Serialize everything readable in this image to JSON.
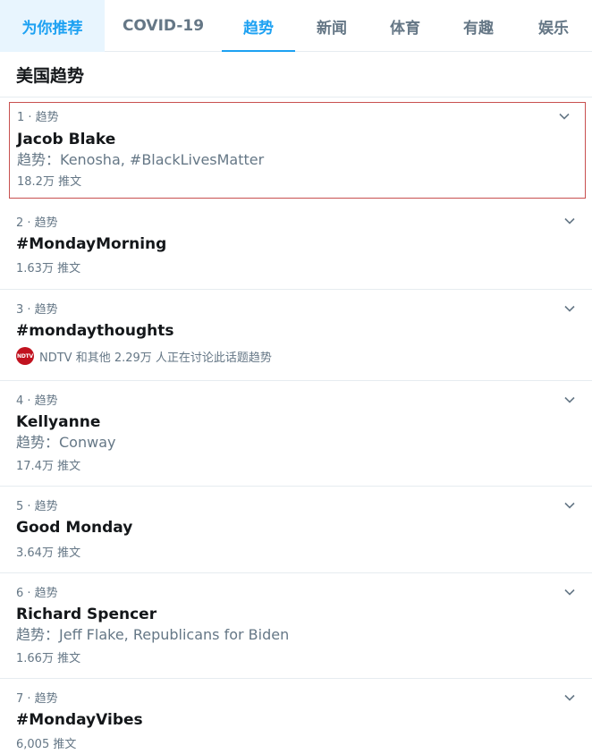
{
  "tabs": [
    {
      "label": "为你推荐"
    },
    {
      "label": "COVID-19"
    },
    {
      "label": "趋势"
    },
    {
      "label": "新闻"
    },
    {
      "label": "体育"
    },
    {
      "label": "有趣"
    },
    {
      "label": "娱乐"
    }
  ],
  "section_title": "美国趋势",
  "trends": [
    {
      "meta": "1 · 趋势",
      "name": "Jacob Blake",
      "context": "趋势：Kenosha, #BlackLivesMatter",
      "count": "18.2万 推文"
    },
    {
      "meta": "2 · 趋势",
      "name": "#MondayMorning",
      "count": "1.63万 推文"
    },
    {
      "meta": "3 · 趋势",
      "name": "#mondaythoughts",
      "mention_badge": "NDTV",
      "mention": "NDTV 和其他 2.29万 人正在讨论此话题趋势"
    },
    {
      "meta": "4 · 趋势",
      "name": "Kellyanne",
      "context": "趋势：Conway",
      "count": "17.4万 推文"
    },
    {
      "meta": "5 · 趋势",
      "name": "Good Monday",
      "count": "3.64万 推文"
    },
    {
      "meta": "6 · 趋势",
      "name": "Richard Spencer",
      "context": "趋势：Jeff Flake, Republicans for Biden",
      "count": "1.66万 推文"
    },
    {
      "meta": "7 · 趋势",
      "name": "#MondayVibes",
      "count": "6,005 推文"
    }
  ],
  "colors": {
    "accent": "#1da1f2",
    "selected_border": "#c8504f"
  },
  "icons": {
    "trend_menu": "chevron-down-icon"
  }
}
